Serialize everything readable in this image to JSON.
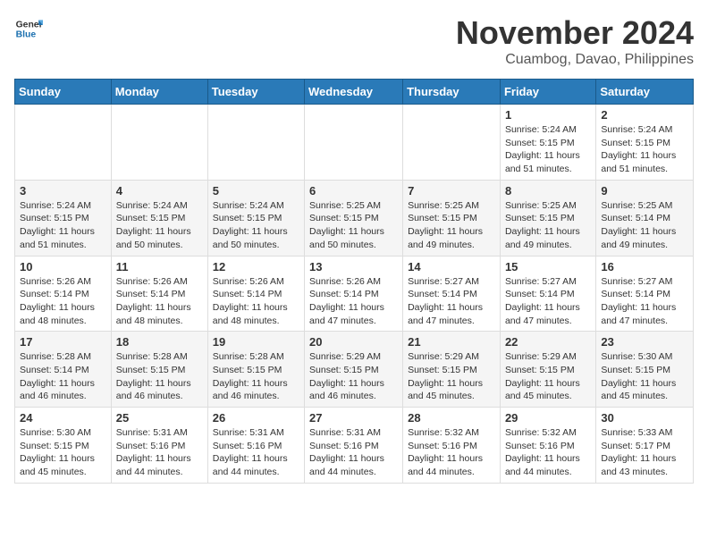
{
  "header": {
    "logo_general": "General",
    "logo_blue": "Blue",
    "month_title": "November 2024",
    "location": "Cuambog, Davao, Philippines"
  },
  "weekdays": [
    "Sunday",
    "Monday",
    "Tuesday",
    "Wednesday",
    "Thursday",
    "Friday",
    "Saturday"
  ],
  "weeks": [
    [
      {
        "day": "",
        "info": ""
      },
      {
        "day": "",
        "info": ""
      },
      {
        "day": "",
        "info": ""
      },
      {
        "day": "",
        "info": ""
      },
      {
        "day": "",
        "info": ""
      },
      {
        "day": "1",
        "info": "Sunrise: 5:24 AM\nSunset: 5:15 PM\nDaylight: 11 hours\nand 51 minutes."
      },
      {
        "day": "2",
        "info": "Sunrise: 5:24 AM\nSunset: 5:15 PM\nDaylight: 11 hours\nand 51 minutes."
      }
    ],
    [
      {
        "day": "3",
        "info": "Sunrise: 5:24 AM\nSunset: 5:15 PM\nDaylight: 11 hours\nand 51 minutes."
      },
      {
        "day": "4",
        "info": "Sunrise: 5:24 AM\nSunset: 5:15 PM\nDaylight: 11 hours\nand 50 minutes."
      },
      {
        "day": "5",
        "info": "Sunrise: 5:24 AM\nSunset: 5:15 PM\nDaylight: 11 hours\nand 50 minutes."
      },
      {
        "day": "6",
        "info": "Sunrise: 5:25 AM\nSunset: 5:15 PM\nDaylight: 11 hours\nand 50 minutes."
      },
      {
        "day": "7",
        "info": "Sunrise: 5:25 AM\nSunset: 5:15 PM\nDaylight: 11 hours\nand 49 minutes."
      },
      {
        "day": "8",
        "info": "Sunrise: 5:25 AM\nSunset: 5:15 PM\nDaylight: 11 hours\nand 49 minutes."
      },
      {
        "day": "9",
        "info": "Sunrise: 5:25 AM\nSunset: 5:14 PM\nDaylight: 11 hours\nand 49 minutes."
      }
    ],
    [
      {
        "day": "10",
        "info": "Sunrise: 5:26 AM\nSunset: 5:14 PM\nDaylight: 11 hours\nand 48 minutes."
      },
      {
        "day": "11",
        "info": "Sunrise: 5:26 AM\nSunset: 5:14 PM\nDaylight: 11 hours\nand 48 minutes."
      },
      {
        "day": "12",
        "info": "Sunrise: 5:26 AM\nSunset: 5:14 PM\nDaylight: 11 hours\nand 48 minutes."
      },
      {
        "day": "13",
        "info": "Sunrise: 5:26 AM\nSunset: 5:14 PM\nDaylight: 11 hours\nand 47 minutes."
      },
      {
        "day": "14",
        "info": "Sunrise: 5:27 AM\nSunset: 5:14 PM\nDaylight: 11 hours\nand 47 minutes."
      },
      {
        "day": "15",
        "info": "Sunrise: 5:27 AM\nSunset: 5:14 PM\nDaylight: 11 hours\nand 47 minutes."
      },
      {
        "day": "16",
        "info": "Sunrise: 5:27 AM\nSunset: 5:14 PM\nDaylight: 11 hours\nand 47 minutes."
      }
    ],
    [
      {
        "day": "17",
        "info": "Sunrise: 5:28 AM\nSunset: 5:14 PM\nDaylight: 11 hours\nand 46 minutes."
      },
      {
        "day": "18",
        "info": "Sunrise: 5:28 AM\nSunset: 5:15 PM\nDaylight: 11 hours\nand 46 minutes."
      },
      {
        "day": "19",
        "info": "Sunrise: 5:28 AM\nSunset: 5:15 PM\nDaylight: 11 hours\nand 46 minutes."
      },
      {
        "day": "20",
        "info": "Sunrise: 5:29 AM\nSunset: 5:15 PM\nDaylight: 11 hours\nand 46 minutes."
      },
      {
        "day": "21",
        "info": "Sunrise: 5:29 AM\nSunset: 5:15 PM\nDaylight: 11 hours\nand 45 minutes."
      },
      {
        "day": "22",
        "info": "Sunrise: 5:29 AM\nSunset: 5:15 PM\nDaylight: 11 hours\nand 45 minutes."
      },
      {
        "day": "23",
        "info": "Sunrise: 5:30 AM\nSunset: 5:15 PM\nDaylight: 11 hours\nand 45 minutes."
      }
    ],
    [
      {
        "day": "24",
        "info": "Sunrise: 5:30 AM\nSunset: 5:15 PM\nDaylight: 11 hours\nand 45 minutes."
      },
      {
        "day": "25",
        "info": "Sunrise: 5:31 AM\nSunset: 5:16 PM\nDaylight: 11 hours\nand 44 minutes."
      },
      {
        "day": "26",
        "info": "Sunrise: 5:31 AM\nSunset: 5:16 PM\nDaylight: 11 hours\nand 44 minutes."
      },
      {
        "day": "27",
        "info": "Sunrise: 5:31 AM\nSunset: 5:16 PM\nDaylight: 11 hours\nand 44 minutes."
      },
      {
        "day": "28",
        "info": "Sunrise: 5:32 AM\nSunset: 5:16 PM\nDaylight: 11 hours\nand 44 minutes."
      },
      {
        "day": "29",
        "info": "Sunrise: 5:32 AM\nSunset: 5:16 PM\nDaylight: 11 hours\nand 44 minutes."
      },
      {
        "day": "30",
        "info": "Sunrise: 5:33 AM\nSunset: 5:17 PM\nDaylight: 11 hours\nand 43 minutes."
      }
    ]
  ]
}
